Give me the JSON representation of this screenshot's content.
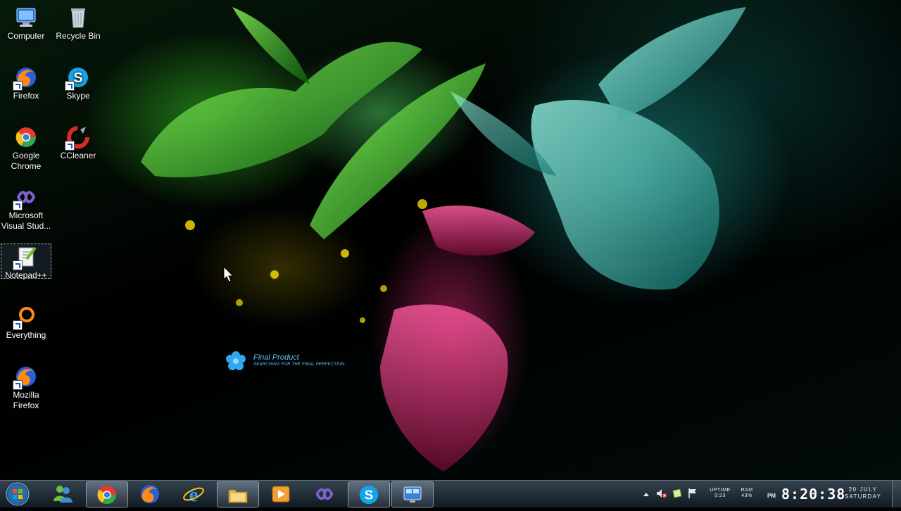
{
  "desktop": {
    "icons": [
      {
        "label": "Computer",
        "icon": "computer-icon"
      },
      {
        "label": "Recycle Bin",
        "icon": "recycle-bin-icon"
      },
      {
        "label": "Firefox",
        "icon": "firefox-icon"
      },
      {
        "label": "Skype",
        "icon": "skype-icon"
      },
      {
        "label": "Google Chrome",
        "icon": "chrome-icon"
      },
      {
        "label": "CCleaner",
        "icon": "ccleaner-icon"
      },
      {
        "label": "Microsoft Visual Stud...",
        "icon": "visual-studio-icon"
      },
      {
        "label": "Notepad++",
        "icon": "notepad-plus-plus-icon",
        "selected": true
      },
      {
        "label": "Everything",
        "icon": "everything-search-icon"
      },
      {
        "label": "Mozilla Firefox",
        "icon": "firefox-icon"
      }
    ],
    "wallpaper_logo": {
      "title": "Final Product",
      "subtitle": "SEARCHING FOR THE FINAL PERFECTION."
    }
  },
  "taskbar": {
    "start_icon": "windows-start-orb-icon",
    "items": [
      {
        "icon": "messenger-icon",
        "active": false
      },
      {
        "icon": "chrome-icon",
        "active": true
      },
      {
        "icon": "firefox-icon",
        "active": false
      },
      {
        "icon": "internet-explorer-icon",
        "active": false
      },
      {
        "icon": "file-explorer-icon",
        "active": true
      },
      {
        "icon": "media-player-icon",
        "active": false
      },
      {
        "icon": "visual-studio-icon",
        "active": false
      },
      {
        "icon": "skype-icon",
        "active": true
      },
      {
        "icon": "remote-desktop-icon",
        "active": true
      }
    ],
    "tray": {
      "icons": [
        "show-hidden-icons-chevron",
        "volume-muted-icon",
        "notification-icon",
        "action-center-flag-icon"
      ],
      "uptime": {
        "label": "UPTIME",
        "value": "0:23"
      },
      "ram": {
        "label": "RAM",
        "value": "43%"
      },
      "clock": {
        "ampm": "PM",
        "time": "8:20:38"
      },
      "date": {
        "day": "20 JULY",
        "weekday": "SATURDAY"
      }
    }
  },
  "colors": {
    "logo_text": "#5fc9ff",
    "taskbar": "#1e2a34",
    "clock_text": "#ffffff"
  }
}
